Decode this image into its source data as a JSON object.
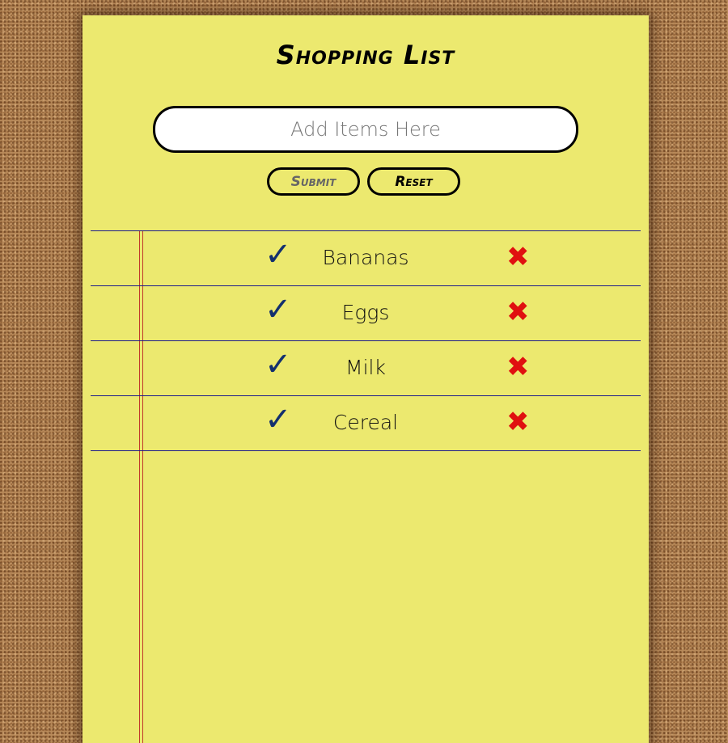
{
  "title": "Shopping List",
  "input": {
    "placeholder": "Add Items Here",
    "value": ""
  },
  "buttons": {
    "submit": "Submit",
    "reset": "Reset"
  },
  "items": [
    {
      "name": "Bananas",
      "check": "✓",
      "delete": "✖"
    },
    {
      "name": "Eggs",
      "check": "✓",
      "delete": "✖"
    },
    {
      "name": "Milk",
      "check": "✓",
      "delete": "✖"
    },
    {
      "name": "Cereal",
      "check": "✓",
      "delete": "✖"
    }
  ]
}
